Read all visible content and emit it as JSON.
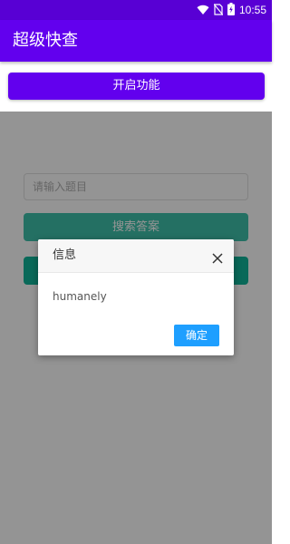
{
  "status_bar": {
    "time": "10:55",
    "icons": [
      "wifi-icon",
      "no-sim-icon",
      "battery-charging-icon"
    ]
  },
  "app_bar": {
    "title": "超级快查",
    "color": "#6200ee"
  },
  "main": {
    "enable_button_label": "开启功能",
    "search_input": {
      "value": "",
      "placeholder": "请输入题目"
    },
    "search_button_label": "搜索答案",
    "second_button_label": ""
  },
  "dialog": {
    "title": "信息",
    "message": "humanely",
    "ok_label": "确定",
    "close_icon": "close-icon",
    "ok_color": "#1e9fff"
  }
}
